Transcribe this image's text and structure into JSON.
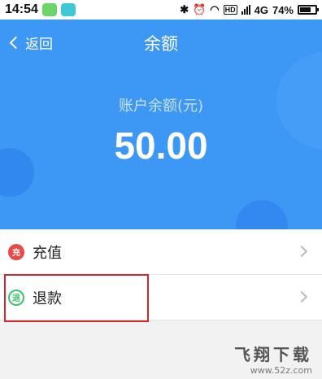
{
  "status_bar": {
    "time": "14:54",
    "network": "4G",
    "hd": "HD",
    "battery_percent": "74%",
    "battery_level": 0.74
  },
  "header": {
    "back_label": "返回",
    "title": "余额"
  },
  "balance": {
    "label": "账户余额(元)",
    "value": "50.00"
  },
  "menu": {
    "items": [
      {
        "icon_text": "充",
        "label": "充值",
        "icon": "recharge-icon"
      },
      {
        "icon_text": "退",
        "label": "退款",
        "icon": "refund-icon"
      }
    ]
  },
  "watermark": {
    "main": "飞翔下载",
    "url": "www.52z.com"
  },
  "colors": {
    "hero": "#3c97f5",
    "recharge_badge": "#e84a4a",
    "refund_badge": "#3cc36b",
    "highlight_box": "#d9252b"
  }
}
